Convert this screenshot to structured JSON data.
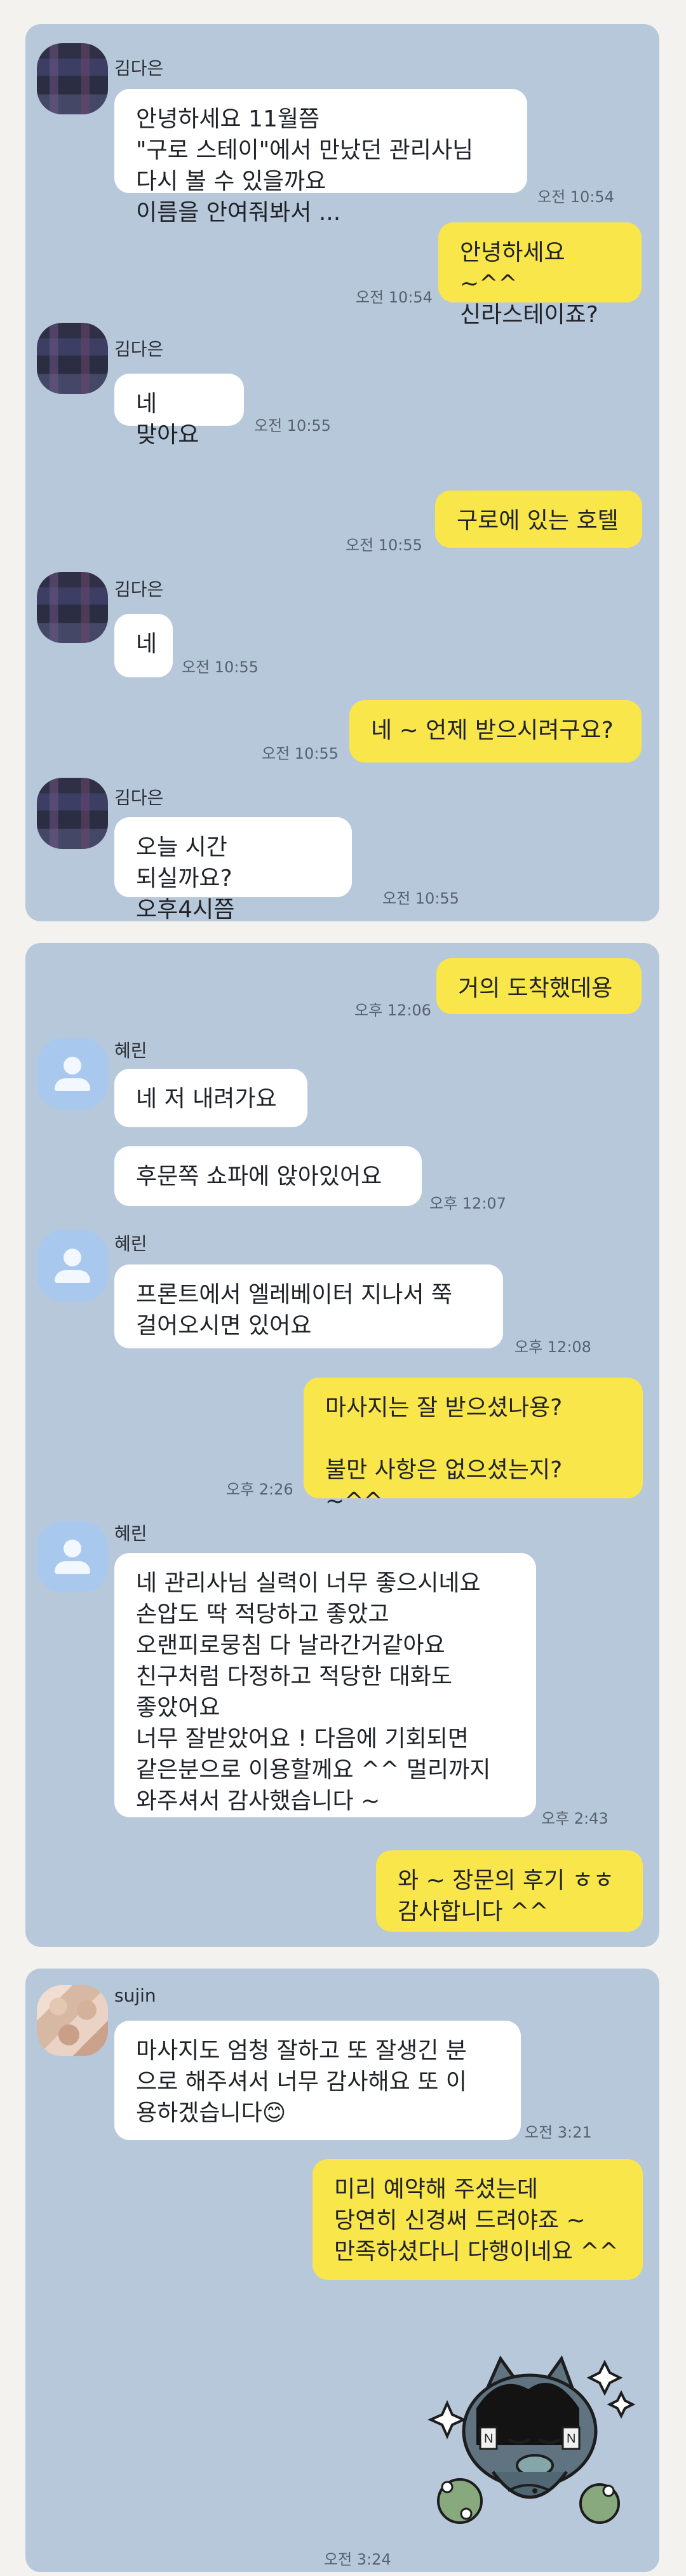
{
  "panels": {
    "p1": {
      "messages": [
        {
          "name": "김다은",
          "text": "안녕하세요 11월쯤\n\"구로 스테이\"에서 만났던 관리사님\n다시 볼 수 있을까요\n이름을 안여줘봐서 ...",
          "time": "오전 10:54"
        },
        {
          "text": "안녕하세요 ~^^\n신라스테이죠?",
          "time": "오전 10:54"
        },
        {
          "name": "김다은",
          "text": "네 맞아요",
          "time": "오전 10:55"
        },
        {
          "text": "구로에 있는 호텔",
          "time": "오전 10:55"
        },
        {
          "name": "김다은",
          "text": "네",
          "time": "오전 10:55"
        },
        {
          "text": "네 ~ 언제 받으시려구요?",
          "time": "오전 10:55"
        },
        {
          "name": "김다은",
          "text": "오늘  시간 되실까요?\n오후4시쯤",
          "time": "오전 10:55"
        }
      ]
    },
    "p2": {
      "messages": [
        {
          "text": "거의 도착했데용",
          "time": "오후 12:06"
        },
        {
          "name": "혜린",
          "text": "네 저 내려가요"
        },
        {
          "text": "후문쪽 쇼파에 앉아있어요",
          "time": "오후 12:07"
        },
        {
          "name": "혜린",
          "text": "프론트에서 엘레베이터 지나서 쭉\n걸어오시면 있어요",
          "time": "오후 12:08"
        },
        {
          "text": "마사지는 잘 받으셨나용?\n\n불만 사항은 없으셨는지? ~^^",
          "time": "오후 2:26"
        },
        {
          "name": "혜린",
          "text": "네 관리사님 실력이 너무 좋으시네요\n손압도 딱 적당하고 좋았고\n오랜피로뭉침 다 날라간거같아요\n친구처럼 다정하고 적당한 대화도\n좋았어요\n너무 잘받았어요 ! 다음에 기회되면\n같은분으로 이용할께요 ^^ 멀리까지\n와주셔서 감사했습니다 ~",
          "time": "오후 2:43"
        },
        {
          "text": "와 ~ 장문의 후기 ㅎㅎ\n감사합니다 ^^"
        }
      ]
    },
    "p3": {
      "messages": [
        {
          "name": "sujin",
          "text": "마사지도 엄청 잘하고 또 잘생긴 분\n으로 해주셔서 너무 감사해요 또 이\n용하겠습니다😊",
          "time": "오전 3:21"
        },
        {
          "text": "미리 예약해 주셨는데\n당연히 신경써 드려야죠 ~\n만족하셨다니 다행이네요 ^^"
        },
        {
          "time": "오전 3:24"
        }
      ]
    }
  }
}
